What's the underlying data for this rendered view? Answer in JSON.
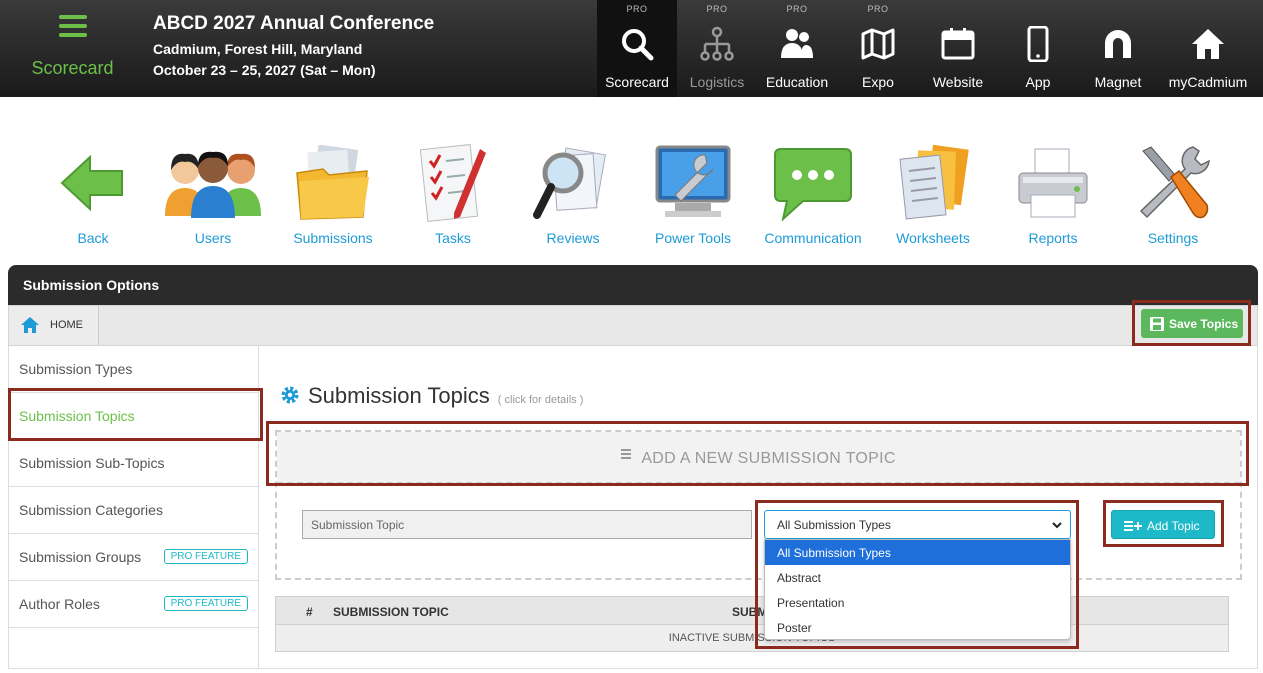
{
  "brand": {
    "label": "Scorecard"
  },
  "conference": {
    "title": "ABCD 2027 Annual Conference",
    "location": "Cadmium, Forest Hill, Maryland",
    "dates": "October 23 – 25, 2027 (Sat – Mon)"
  },
  "nav": [
    {
      "label": "Scorecard",
      "pro": "PRO",
      "icon": "search-icon"
    },
    {
      "label": "Logistics",
      "pro": "PRO",
      "icon": "hierarchy-icon"
    },
    {
      "label": "Education",
      "pro": "PRO",
      "icon": "people-icon"
    },
    {
      "label": "Expo",
      "pro": "PRO",
      "icon": "map-icon"
    },
    {
      "label": "Website",
      "pro": "",
      "icon": "browser-icon"
    },
    {
      "label": "App",
      "pro": "",
      "icon": "phone-icon"
    },
    {
      "label": "Magnet",
      "pro": "",
      "icon": "magnet-icon"
    },
    {
      "label": "myCadmium",
      "pro": "",
      "icon": "home-icon"
    }
  ],
  "tools": [
    {
      "label": "Back",
      "icon": "back-arrow-icon"
    },
    {
      "label": "Users",
      "icon": "users-icon"
    },
    {
      "label": "Submissions",
      "icon": "folder-icon"
    },
    {
      "label": "Tasks",
      "icon": "checklist-icon"
    },
    {
      "label": "Reviews",
      "icon": "magnifier-icon"
    },
    {
      "label": "Power Tools",
      "icon": "wrench-monitor-icon"
    },
    {
      "label": "Communication",
      "icon": "chat-bubble-icon"
    },
    {
      "label": "Worksheets",
      "icon": "worksheets-icon"
    },
    {
      "label": "Reports",
      "icon": "printer-icon"
    },
    {
      "label": "Settings",
      "icon": "tools-icon"
    }
  ],
  "panel": {
    "title": "Submission Options"
  },
  "breadcrumb": {
    "home": "HOME"
  },
  "save_button": "Save Topics",
  "sidebar": [
    {
      "label": "Submission Types",
      "badge": ""
    },
    {
      "label": "Submission Topics",
      "badge": ""
    },
    {
      "label": "Submission Sub-Topics",
      "badge": ""
    },
    {
      "label": "Submission Categories",
      "badge": ""
    },
    {
      "label": "Submission Groups",
      "badge": "PRO FEATURE"
    },
    {
      "label": "Author Roles",
      "badge": "PRO FEATURE"
    }
  ],
  "section": {
    "title": "Submission Topics",
    "hint": "( click for details )"
  },
  "add_section": {
    "header": "ADD A NEW SUBMISSION TOPIC"
  },
  "form": {
    "topic_placeholder": "Submission Topic",
    "type_selected": "All Submission Types",
    "type_options": [
      "All Submission Types",
      "Abstract",
      "Presentation",
      "Poster"
    ],
    "add_button": "Add Topic"
  },
  "table": {
    "col_num": "#",
    "col_topic": "SUBMISSION TOPIC",
    "col_type": "SUBMI",
    "inactive_label": "INACTIVE SUBMISSION TOPICS"
  },
  "colors": {
    "accent_green": "#6cc04a",
    "link_blue": "#1e9bd7",
    "teal": "#1eb9c9",
    "highlight": "#8b2a1e"
  }
}
